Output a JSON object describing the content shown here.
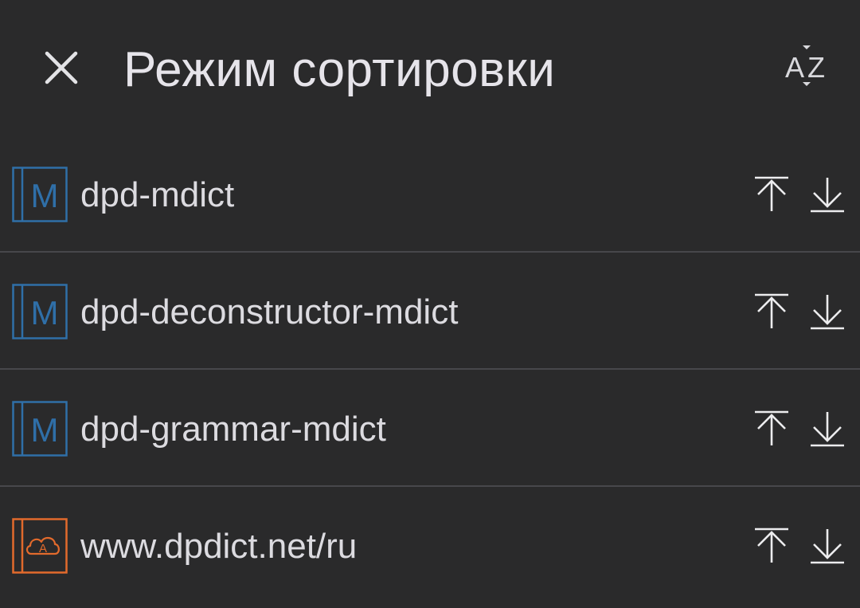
{
  "header": {
    "title": "Режим сортировки",
    "close_icon": "close-icon",
    "sort_icon": "sort-az-icon",
    "sort_label_a": "A",
    "sort_label_z": "Z"
  },
  "colors": {
    "background": "#2a2a2b",
    "mdict_icon": "#2f6fa8",
    "web_icon": "#e26a2c",
    "divider": "#47474b",
    "text": "#dcdbe0"
  },
  "dictionaries": [
    {
      "name": "dpd-mdict",
      "icon": "mdict-book-icon",
      "icon_letter": "M"
    },
    {
      "name": "dpd-deconstructor-mdict",
      "icon": "mdict-book-icon",
      "icon_letter": "M"
    },
    {
      "name": "dpd-grammar-mdict",
      "icon": "mdict-book-icon",
      "icon_letter": "M"
    },
    {
      "name": "www.dpdict.net/ru",
      "icon": "web-dictionary-icon",
      "icon_letter": "A"
    }
  ]
}
